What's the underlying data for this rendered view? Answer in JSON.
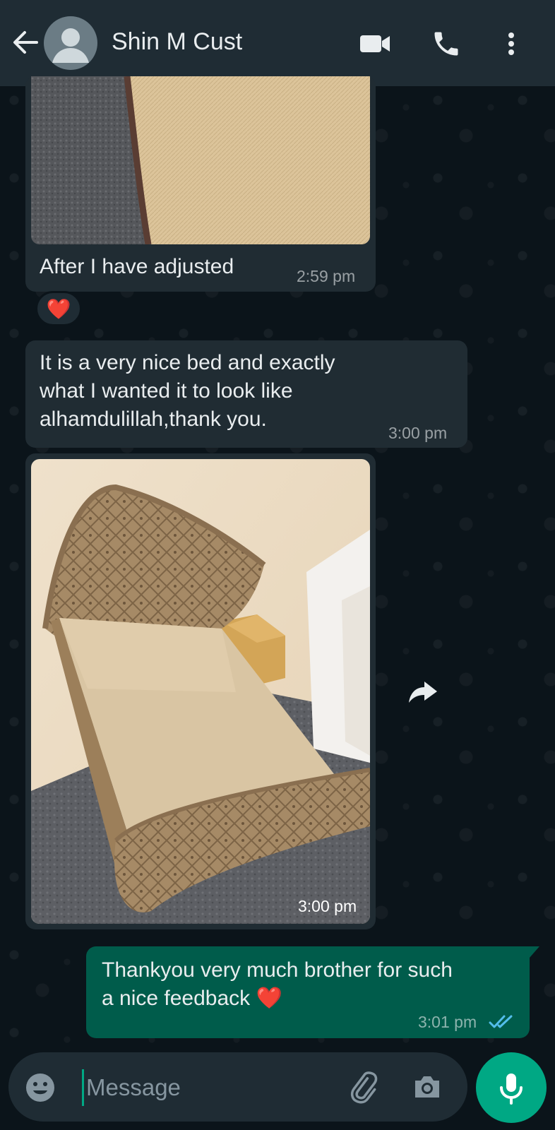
{
  "header": {
    "contact_name": "Shin M Cust",
    "icons": [
      "back-arrow-icon",
      "avatar-icon",
      "video-call-icon",
      "voice-call-icon",
      "more-vert-icon"
    ]
  },
  "messages": [
    {
      "type": "image-caption",
      "direction": "incoming",
      "caption": "After I have adjusted",
      "time": "2:59 pm",
      "reaction": "❤️"
    },
    {
      "type": "text",
      "direction": "incoming",
      "lines": [
        "It is a very nice bed and exactly",
        "what I wanted it to look like",
        "alhamdulillah,thank you."
      ],
      "time": "3:00 pm"
    },
    {
      "type": "image",
      "direction": "incoming",
      "time": "3:00 pm"
    },
    {
      "type": "text",
      "direction": "outgoing",
      "lines": [
        "Thankyou very much brother for such",
        "a nice feedback ❤️"
      ],
      "time": "3:01 pm",
      "status": "read"
    }
  ],
  "composer": {
    "placeholder": "Message",
    "icons": [
      "emoji-icon",
      "attach-icon",
      "camera-icon",
      "mic-icon"
    ]
  },
  "colors": {
    "header_bg": "#1f2c34",
    "chat_bg": "#0b141a",
    "incoming_bubble": "#202c33",
    "outgoing_bubble": "#005c4b",
    "accent": "#00a884",
    "read_ticks": "#53bdeb"
  }
}
